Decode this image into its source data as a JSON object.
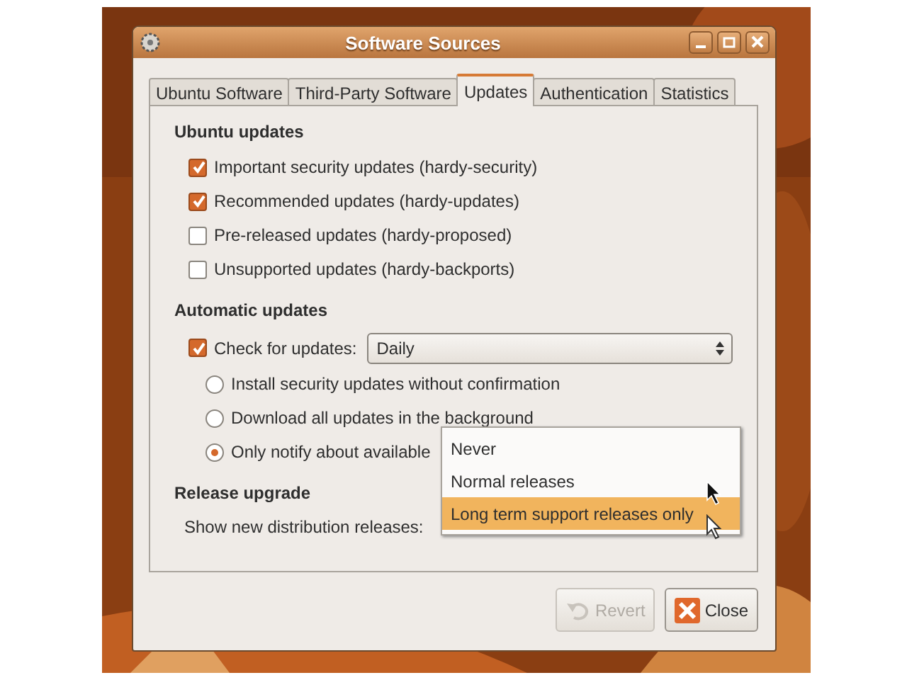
{
  "window": {
    "title": "Software Sources"
  },
  "tabs": [
    {
      "label": "Ubuntu Software",
      "selected": false
    },
    {
      "label": "Third-Party Software",
      "selected": false
    },
    {
      "label": "Updates",
      "selected": true
    },
    {
      "label": "Authentication",
      "selected": false
    },
    {
      "label": "Statistics",
      "selected": false
    }
  ],
  "ubuntu_updates": {
    "heading": "Ubuntu updates",
    "options": [
      {
        "label": "Important security updates (hardy-security)",
        "checked": true
      },
      {
        "label": "Recommended updates (hardy-updates)",
        "checked": true
      },
      {
        "label": "Pre-released updates (hardy-proposed)",
        "checked": false
      },
      {
        "label": "Unsupported updates (hardy-backports)",
        "checked": false
      }
    ]
  },
  "automatic_updates": {
    "heading": "Automatic updates",
    "check": {
      "label": "Check for updates:",
      "checked": true
    },
    "frequency": {
      "value": "Daily"
    },
    "options": [
      {
        "label": "Install security updates without confirmation",
        "selected": false
      },
      {
        "label": "Download all updates in the background",
        "selected": false
      },
      {
        "label": "Only notify about available",
        "selected": true
      }
    ]
  },
  "release_upgrade": {
    "heading": "Release upgrade",
    "label": "Show new distribution releases:",
    "menu": [
      {
        "label": "Never",
        "selected": false
      },
      {
        "label": "Normal releases",
        "selected": false
      },
      {
        "label": "Long term support releases only",
        "selected": true
      }
    ]
  },
  "buttons": [
    {
      "label": "Revert",
      "disabled": true
    },
    {
      "label": "Close",
      "disabled": false
    }
  ]
}
